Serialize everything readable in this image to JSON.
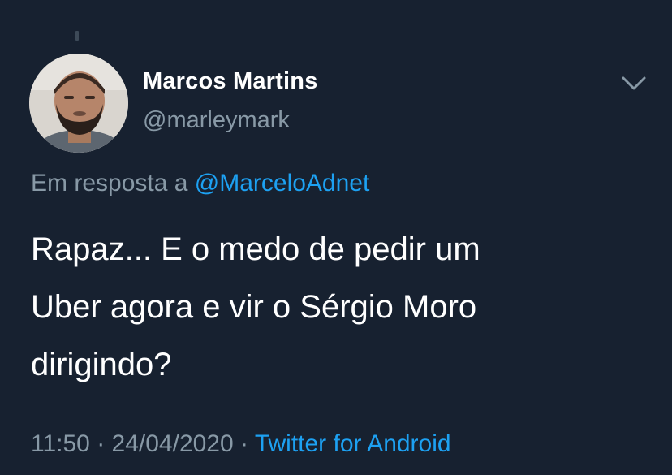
{
  "tweet": {
    "author_name": "Marcos Martins",
    "author_handle": "@marleymark",
    "reply_prefix": "Em resposta a ",
    "reply_mention": "@MarceloAdnet",
    "text_lines": [
      "Rapaz... E o medo de pedir um",
      "Uber agora e vir o Sérgio Moro",
      "dirigindo?"
    ],
    "time": "11:50",
    "date": "24/04/2020",
    "separator": " · ",
    "source": "Twitter for Android"
  },
  "icons": {
    "menu": "chevron-down-icon",
    "avatar": "avatar"
  },
  "colors": {
    "background": "#172130",
    "primary_text": "#ffffff",
    "secondary_text": "#8899a6",
    "link": "#1da1f2"
  }
}
